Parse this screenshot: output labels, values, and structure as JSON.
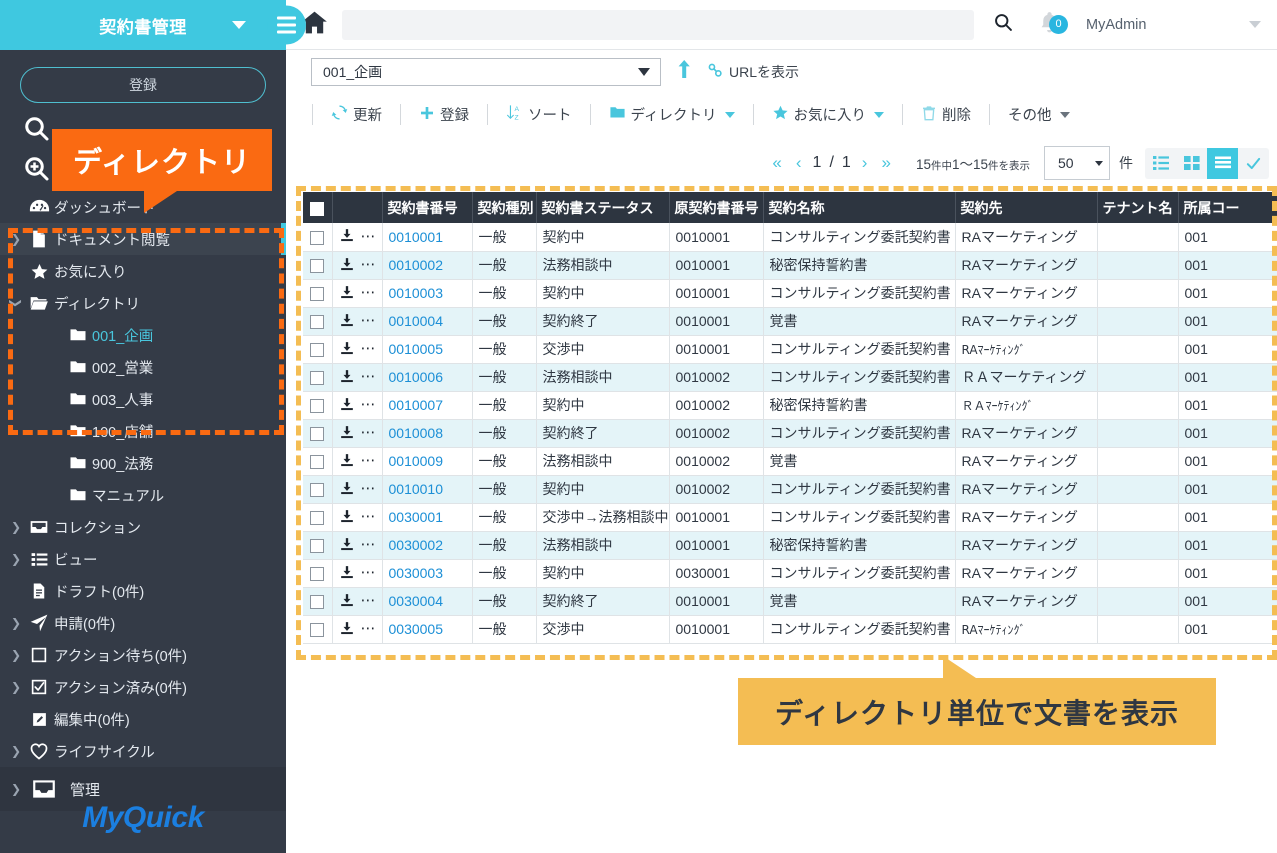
{
  "sidebar": {
    "title": "契約書管理",
    "register_button": "登録",
    "logo": "MyQuick",
    "icon_row": [
      "search-icon",
      "advanced-search-icon"
    ],
    "items": [
      {
        "label": "ダッシュボード",
        "icon": "dashboard-icon",
        "chevron": false,
        "indent": false,
        "active": false,
        "teal": false
      },
      {
        "label": "ドキュメント閲覧",
        "icon": "document-icon",
        "chevron": true,
        "indent": false,
        "active": true,
        "teal": false
      },
      {
        "label": "お気に入り",
        "icon": "star-icon",
        "chevron": false,
        "indent": false,
        "active": false,
        "teal": false
      },
      {
        "label": "ディレクトリ",
        "icon": "folder-open-icon",
        "chevron": true,
        "expanded": true,
        "indent": false,
        "active": false,
        "teal": false
      },
      {
        "label": "001_企画",
        "icon": "folder-icon",
        "chevron": false,
        "indent": true,
        "active": false,
        "teal": true
      },
      {
        "label": "002_営業",
        "icon": "folder-icon",
        "chevron": false,
        "indent": true,
        "active": false,
        "teal": false
      },
      {
        "label": "003_人事",
        "icon": "folder-icon",
        "chevron": false,
        "indent": true,
        "active": false,
        "teal": false
      },
      {
        "label": "100_店舗",
        "icon": "folder-icon",
        "chevron": false,
        "indent": true,
        "active": false,
        "teal": false
      },
      {
        "label": "900_法務",
        "icon": "folder-icon",
        "chevron": false,
        "indent": true,
        "active": false,
        "teal": false
      },
      {
        "label": "マニュアル",
        "icon": "folder-icon",
        "chevron": false,
        "indent": true,
        "active": false,
        "teal": false
      },
      {
        "label": "コレクション",
        "icon": "collection-icon",
        "chevron": true,
        "indent": false,
        "active": false,
        "teal": false
      },
      {
        "label": "ビュー",
        "icon": "view-list-icon",
        "chevron": true,
        "indent": false,
        "active": false,
        "teal": false
      },
      {
        "label": "ドラフト(0件)",
        "icon": "draft-icon",
        "chevron": false,
        "indent": false,
        "active": false,
        "teal": false
      },
      {
        "label": "申請(0件)",
        "icon": "send-icon",
        "chevron": true,
        "indent": false,
        "active": false,
        "teal": false
      },
      {
        "label": "アクション待ち(0件)",
        "icon": "square-icon",
        "chevron": true,
        "indent": false,
        "active": false,
        "teal": false
      },
      {
        "label": "アクション済み(0件)",
        "icon": "checked-square-icon",
        "chevron": true,
        "indent": false,
        "active": false,
        "teal": false
      },
      {
        "label": "編集中(0件)",
        "icon": "pencil-icon",
        "chevron": false,
        "indent": false,
        "active": false,
        "teal": false
      },
      {
        "label": "ライフサイクル",
        "icon": "heart-icon",
        "chevron": true,
        "indent": false,
        "active": false,
        "teal": false
      }
    ],
    "admin_item": {
      "label": "管理",
      "icon": "inbox-icon",
      "chevron": true
    }
  },
  "topbar": {
    "home_icon": "home-icon",
    "search_placeholder": "",
    "search_value": "",
    "search_icon": "search-icon",
    "bell_icon": "bell-icon",
    "bell_badge": "0",
    "user_name": "MyAdmin"
  },
  "dirbar": {
    "selected_directory": "001_企画",
    "up_icon": "move-up-icon",
    "url_link": "URLを表示",
    "url_icon": "link-icon"
  },
  "toolbar": {
    "buttons": [
      {
        "label": "更新",
        "icon": "refresh-icon",
        "caret": false
      },
      {
        "label": "登録",
        "icon": "plus-icon",
        "caret": false
      },
      {
        "label": "ソート",
        "icon": "sort-az-icon",
        "caret": false
      },
      {
        "label": "ディレクトリ",
        "icon": "folder-icon",
        "caret": true
      },
      {
        "label": "お気に入り",
        "icon": "star-icon",
        "caret": true
      },
      {
        "label": "削除",
        "icon": "trash-icon",
        "caret": false
      },
      {
        "label": "その他",
        "icon": "",
        "caret": true,
        "caret_grey": true
      }
    ]
  },
  "pager": {
    "first_icon": "«",
    "prev_icon": "‹",
    "page_current": "1",
    "page_separator": "/",
    "page_total": "1",
    "next_icon": "›",
    "last_icon": "»",
    "count_prefix": "15",
    "count_mid_label": "件中",
    "count_range": "1〜15",
    "count_suffix_label": "件を表示",
    "page_size": "50",
    "unit_label": "件",
    "views": [
      {
        "name": "list-view-icon",
        "active": false
      },
      {
        "name": "grid-view-icon",
        "active": false
      },
      {
        "name": "table-view-icon",
        "active": true
      },
      {
        "name": "check-view-icon",
        "active": false
      }
    ]
  },
  "table": {
    "columns": [
      "",
      "",
      "契約書番号",
      "契約種別",
      "契約書ステータス",
      "原契約書番号",
      "契約名称",
      "契約先",
      "テナント名",
      "所属コー"
    ],
    "rows": [
      {
        "no": "0010001",
        "type": "一般",
        "status": "契約中",
        "orig": "0010001",
        "name": "コンサルティング委託契約書",
        "customer": "RAマーケティング",
        "customer_hw": false,
        "tenant": "",
        "code": "001"
      },
      {
        "no": "0010002",
        "type": "一般",
        "status": "法務相談中",
        "orig": "0010001",
        "name": "秘密保持誓約書",
        "customer": "RAマーケティング",
        "customer_hw": false,
        "tenant": "",
        "code": "001"
      },
      {
        "no": "0010003",
        "type": "一般",
        "status": "契約中",
        "orig": "0010001",
        "name": "コンサルティング委託契約書",
        "customer": "RAマーケティング",
        "customer_hw": false,
        "tenant": "",
        "code": "001"
      },
      {
        "no": "0010004",
        "type": "一般",
        "status": "契約終了",
        "orig": "0010001",
        "name": "覚書",
        "customer": "RAマーケティング",
        "customer_hw": false,
        "tenant": "",
        "code": "001"
      },
      {
        "no": "0010005",
        "type": "一般",
        "status": "交渉中",
        "orig": "0010001",
        "name": "コンサルティング委託契約書",
        "customer": "RAﾏｰｹﾃｨﾝｸﾞ",
        "customer_hw": true,
        "tenant": "",
        "code": "001"
      },
      {
        "no": "0010006",
        "type": "一般",
        "status": "法務相談中",
        "orig": "0010002",
        "name": "コンサルティング委託契約書",
        "customer": "ＲＡマーケティング",
        "customer_hw": false,
        "tenant": "",
        "code": "001"
      },
      {
        "no": "0010007",
        "type": "一般",
        "status": "契約中",
        "orig": "0010002",
        "name": "秘密保持誓約書",
        "customer": "ＲＡﾏｰｹﾃｨﾝｸﾞ",
        "customer_hw": true,
        "tenant": "",
        "code": "001"
      },
      {
        "no": "0010008",
        "type": "一般",
        "status": "契約終了",
        "orig": "0010002",
        "name": "コンサルティング委託契約書",
        "customer": "RAマーケティング",
        "customer_hw": false,
        "tenant": "",
        "code": "001"
      },
      {
        "no": "0010009",
        "type": "一般",
        "status": "法務相談中",
        "orig": "0010002",
        "name": "覚書",
        "customer": "RAマーケティング",
        "customer_hw": false,
        "tenant": "",
        "code": "001"
      },
      {
        "no": "0010010",
        "type": "一般",
        "status": "契約中",
        "orig": "0010002",
        "name": "コンサルティング委託契約書",
        "customer": "RAマーケティング",
        "customer_hw": false,
        "tenant": "",
        "code": "001"
      },
      {
        "no": "0030001",
        "type": "一般",
        "status": "交渉中→法務相談中",
        "orig": "0010001",
        "name": "コンサルティング委託契約書",
        "customer": "RAマーケティング",
        "customer_hw": false,
        "tenant": "",
        "code": "001"
      },
      {
        "no": "0030002",
        "type": "一般",
        "status": "法務相談中",
        "orig": "0010001",
        "name": "秘密保持誓約書",
        "customer": "RAマーケティング",
        "customer_hw": false,
        "tenant": "",
        "code": "001"
      },
      {
        "no": "0030003",
        "type": "一般",
        "status": "契約中",
        "orig": "0030001",
        "name": "コンサルティング委託契約書",
        "customer": "RAマーケティング",
        "customer_hw": false,
        "tenant": "",
        "code": "001"
      },
      {
        "no": "0030004",
        "type": "一般",
        "status": "契約終了",
        "orig": "0010001",
        "name": "覚書",
        "customer": "RAマーケティング",
        "customer_hw": false,
        "tenant": "",
        "code": "001"
      },
      {
        "no": "0030005",
        "type": "一般",
        "status": "交渉中",
        "orig": "0010001",
        "name": "コンサルティング委託契約書",
        "customer": "RAﾏｰｹﾃｨﾝｸﾞ",
        "customer_hw": true,
        "tenant": "",
        "code": "001"
      }
    ]
  },
  "annotations": {
    "directory_callout": "ディレクトリ",
    "table_callout": "ディレクトリ単位で文書を表示"
  },
  "colors": {
    "brand_cyan": "#3fc8e0",
    "sidebar_dark": "#343b47",
    "header_dark": "#2d3540",
    "accent_orange": "#fa6a12",
    "accent_yellow": "#f4bd53",
    "link_blue": "#1c8fd6",
    "logo_blue": "#1b7fe0"
  }
}
